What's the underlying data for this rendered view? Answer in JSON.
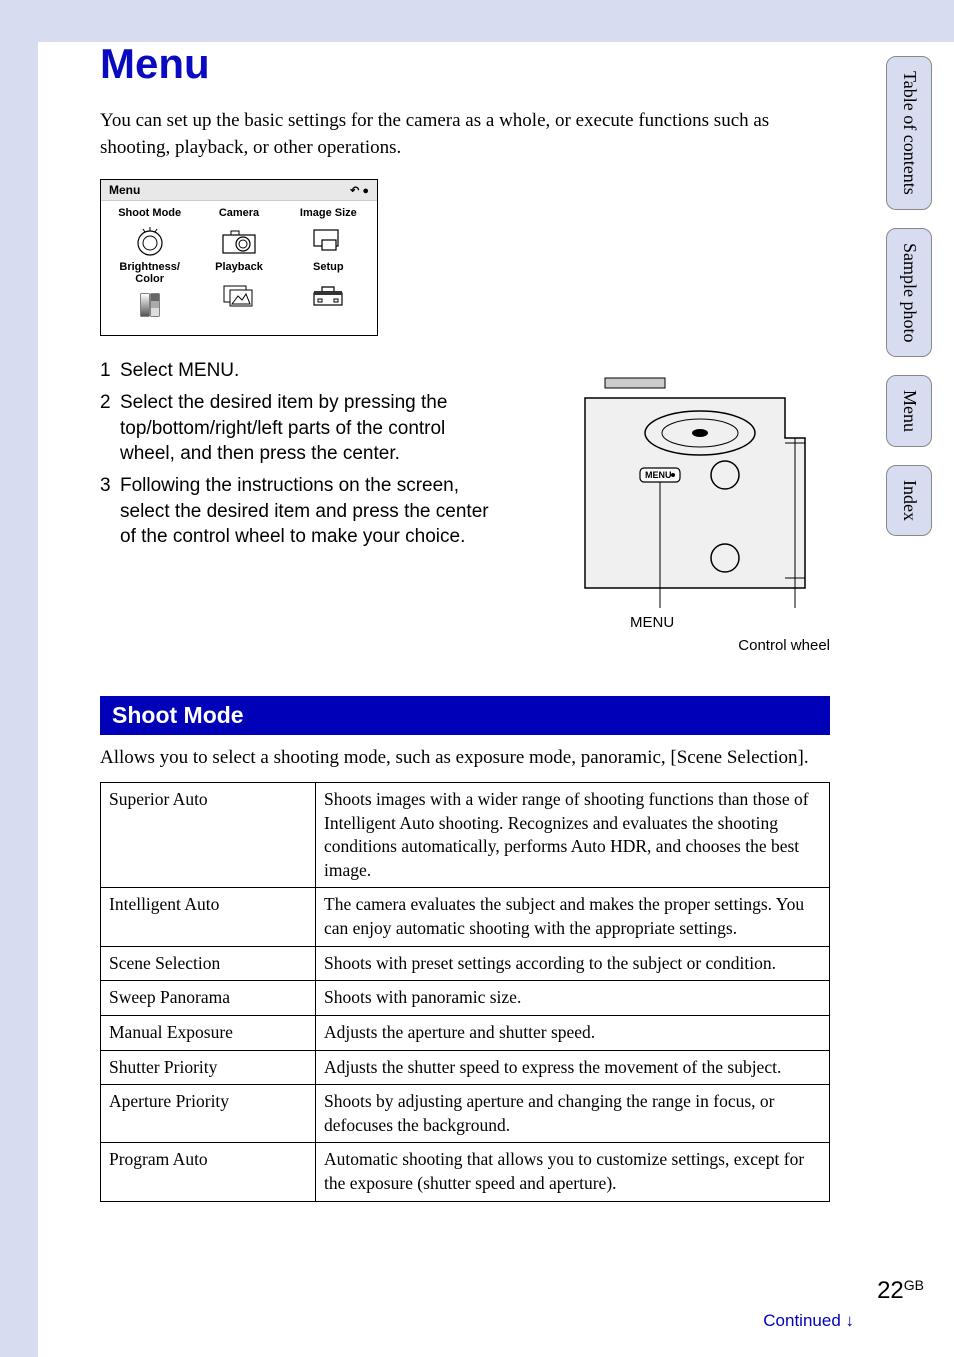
{
  "page": {
    "title": "Menu",
    "intro": "You can set up the basic settings for the camera as a whole, or execute functions such as shooting, playback, or other operations.",
    "pageNumber": "22",
    "pageSuffix": "GB",
    "continued": "Continued ↓"
  },
  "sideTabs": [
    "Table of contents",
    "Sample photo",
    "Menu",
    "Index"
  ],
  "menuScreen": {
    "header": "Menu",
    "backIcon": "↶ ●",
    "cells": [
      "Shoot Mode",
      "Camera",
      "Image Size",
      "Brightness/\nColor",
      "Playback",
      "Setup"
    ]
  },
  "steps": [
    {
      "num": "1",
      "text": "Select MENU."
    },
    {
      "num": "2",
      "text": "Select the desired item by pressing the top/bottom/right/left parts of the control wheel, and then press the center."
    },
    {
      "num": "3",
      "text": "Following the instructions on the screen, select the desired item and press the center of the control wheel to make your choice."
    }
  ],
  "diagram": {
    "menuLabel": "MENU",
    "wheelLabel": "Control wheel",
    "menuButtonText": "MENU"
  },
  "section": {
    "title": "Shoot Mode",
    "intro": "Allows you to select a shooting mode, such as exposure mode, panoramic, [Scene Selection]."
  },
  "shootTable": [
    {
      "name": "Superior Auto",
      "desc": "Shoots images with a wider range of shooting functions than those of Intelligent Auto shooting. Recognizes and evaluates the shooting conditions automatically, performs Auto HDR, and chooses the best image."
    },
    {
      "name": "Intelligent Auto",
      "desc": "The camera evaluates the subject and makes the proper settings. You can enjoy automatic shooting with the appropriate settings."
    },
    {
      "name": "Scene Selection",
      "desc": "Shoots with preset settings according to the subject or condition."
    },
    {
      "name": "Sweep Panorama",
      "desc": "Shoots with panoramic size."
    },
    {
      "name": "Manual Exposure",
      "desc": "Adjusts the aperture and shutter speed."
    },
    {
      "name": "Shutter Priority",
      "desc": "Adjusts the shutter speed to express the movement of the subject."
    },
    {
      "name": "Aperture Priority",
      "desc": "Shoots by adjusting aperture and changing the range in focus, or defocuses the background."
    },
    {
      "name": "Program Auto",
      "desc": "Automatic shooting that allows you to customize settings, except for the exposure (shutter speed and aperture)."
    }
  ]
}
